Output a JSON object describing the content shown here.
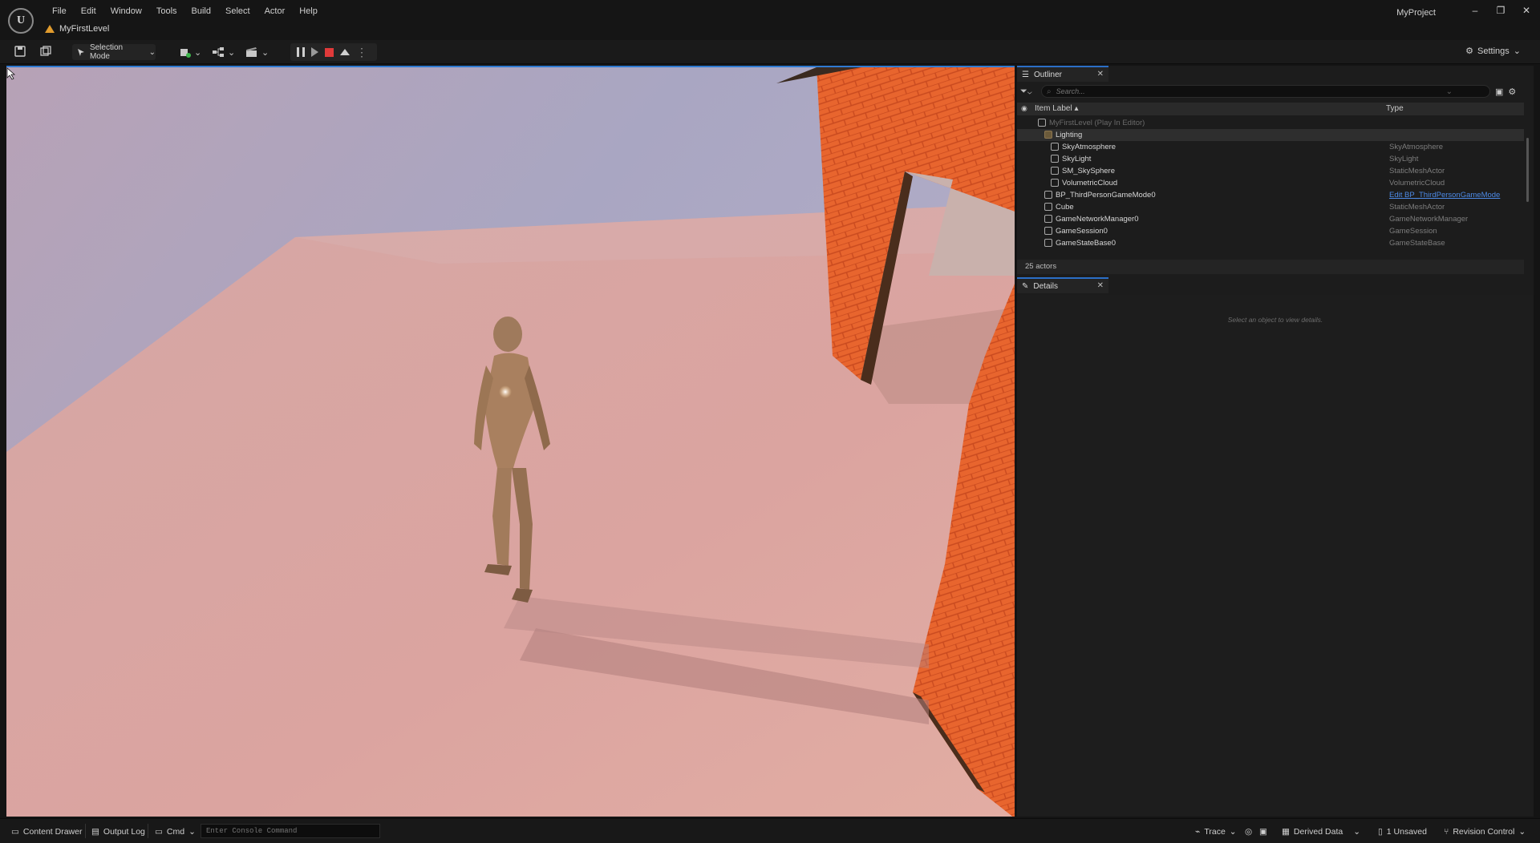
{
  "window": {
    "project": "MyProject",
    "level_tab": "MyFirstLevel",
    "logo_text": "U",
    "controls": [
      "–",
      "❐",
      "✕"
    ]
  },
  "menu": [
    "File",
    "Edit",
    "Window",
    "Tools",
    "Build",
    "Select",
    "Actor",
    "Help"
  ],
  "toolbar": {
    "selection_mode": "Selection Mode",
    "settings": "Settings"
  },
  "outliner": {
    "tab_label": "Outliner",
    "search_placeholder": "Search...",
    "col_label": "Item Label ▴",
    "col_type": "Type",
    "rows": [
      {
        "name": "MyFirstLevel (Play In Editor)",
        "type": "",
        "indent": 0,
        "dim": true
      },
      {
        "name": "Lighting",
        "type": "",
        "indent": 1,
        "folder": true,
        "sel": true
      },
      {
        "name": "SkyAtmosphere",
        "type": "SkyAtmosphere",
        "indent": 2
      },
      {
        "name": "SkyLight",
        "type": "SkyLight",
        "indent": 2
      },
      {
        "name": "SM_SkySphere",
        "type": "StaticMeshActor",
        "indent": 2
      },
      {
        "name": "VolumetricCloud",
        "type": "VolumetricCloud",
        "indent": 2
      },
      {
        "name": "BP_ThirdPersonGameMode0",
        "type": "Edit BP_ThirdPersonGameMode",
        "indent": 1,
        "link": true
      },
      {
        "name": "Cube",
        "type": "StaticMeshActor",
        "indent": 1
      },
      {
        "name": "GameNetworkManager0",
        "type": "GameNetworkManager",
        "indent": 1
      },
      {
        "name": "GameSession0",
        "type": "GameSession",
        "indent": 1
      },
      {
        "name": "GameStateBase0",
        "type": "GameStateBase",
        "indent": 1
      }
    ],
    "count": "25 actors"
  },
  "details": {
    "tab_label": "Details",
    "hint": "Select an object to view details."
  },
  "statusbar": {
    "content_drawer": "Content Drawer",
    "output_log": "Output Log",
    "cmd": "Cmd",
    "console_placeholder": "Enter Console Command",
    "trace": "Trace",
    "derived_data": "Derived Data",
    "unsaved": "1 Unsaved",
    "revision_control": "Revision Control"
  },
  "colors": {
    "accent": "#2b6fc7",
    "stop": "#e03a3a",
    "warning": "#e09b2d",
    "link": "#4d8ae6"
  }
}
